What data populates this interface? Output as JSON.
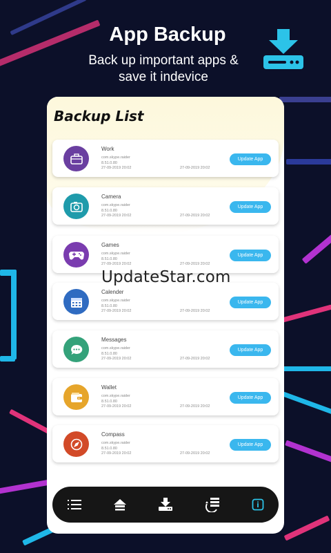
{
  "header": {
    "title": "App Backup",
    "subtitle_line1": "Back up important apps &",
    "subtitle_line2": "save it indevice"
  },
  "list_title": "Backup List",
  "items": [
    {
      "name": "Work",
      "package": "com.skype.raider",
      "version": "8.51.0.80",
      "date1": "27-09-2019 20:02",
      "date2": "27-09-2019 20:02",
      "button": "Update App",
      "icon": "briefcase-icon",
      "color": "#6a3fa0"
    },
    {
      "name": "Camera",
      "package": "com.skype.raider",
      "version": "8.51.0.80",
      "date1": "27-09-2019 20:02",
      "date2": "27-09-2019 20:02",
      "button": "Update App",
      "icon": "camera-icon",
      "color": "#1f9bab"
    },
    {
      "name": "Games",
      "package": "com.skype.raider",
      "version": "8.51.0.80",
      "date1": "27-09-2019 20:02",
      "date2": "27-09-2019 20:02",
      "button": "Update App",
      "icon": "gamepad-icon",
      "color": "#7a3caf"
    },
    {
      "name": "Calender",
      "package": "com.skype.raider",
      "version": "8.51.0.80",
      "date1": "27-09-2019 20:02",
      "date2": "27-09-2019 20:02",
      "button": "Update App",
      "icon": "calendar-icon",
      "color": "#2f6bc1"
    },
    {
      "name": "Messages",
      "package": "com.skype.raider",
      "version": "8.51.0.80",
      "date1": "27-09-2019 20:02",
      "date2": "27-09-2019 20:02",
      "button": "Update App",
      "icon": "chat-icon",
      "color": "#34a27a"
    },
    {
      "name": "Wallet",
      "package": "com.skype.raider",
      "version": "8.51.0.80",
      "date1": "27-09-2019 20:02",
      "date2": "27-09-2019 20:02",
      "button": "Update App",
      "icon": "wallet-icon",
      "color": "#e6a52b"
    },
    {
      "name": "Compass",
      "package": "com.skype.raider",
      "version": "8.51.0.80",
      "date1": "27-09-2019 20:02",
      "date2": "27-09-2019 20:02",
      "button": "Update App",
      "icon": "compass-icon",
      "color": "#d24a28"
    }
  ],
  "watermark": "UpdateStar.com",
  "nav": {
    "items": [
      "menu-icon",
      "home-icon",
      "download-icon",
      "restore-icon",
      "info-icon"
    ],
    "active": "info-icon"
  },
  "colors": {
    "background": "#0c1029",
    "accent": "#3ab7ee",
    "navbar": "#161616"
  }
}
